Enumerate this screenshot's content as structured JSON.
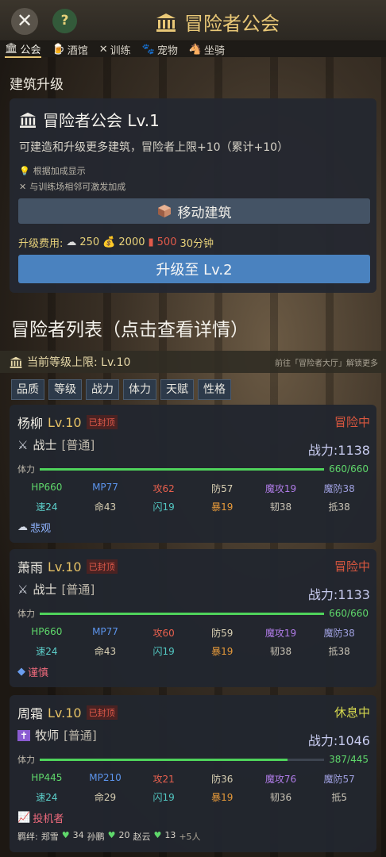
{
  "header": {
    "title": "冒险者公会",
    "close": "✕",
    "help": "?"
  },
  "tabs": [
    {
      "icon": "🏛",
      "label": "公会"
    },
    {
      "icon": "🍺",
      "label": "酒馆"
    },
    {
      "icon": "✕",
      "label": "训练"
    },
    {
      "icon": "🐾",
      "label": "宠物"
    },
    {
      "icon": "🐴",
      "label": "坐骑"
    }
  ],
  "section_title": "建筑升级",
  "building": {
    "name": "冒险者公会 Lv.1",
    "desc": "可建造和升级更多建筑，冒险者上限+10（累计+10）",
    "hint1": "根据加成显示",
    "hint2": "与训练场相邻可激发加成",
    "move_label": "移动建筑",
    "cost_label": "升级费用:",
    "cost_stone": "250",
    "cost_gold": "2000",
    "cost_red": "500",
    "cost_time": "30分钟",
    "upgrade_label": "升级至 Lv.2"
  },
  "list_title": "冒险者列表（点击查看详情）",
  "level_cap": "当前等级上限: Lv.10",
  "goto": "前往「冒险者大厅」解锁更多",
  "filters": [
    "品质",
    "等级",
    "战力",
    "体力",
    "天赋",
    "性格"
  ],
  "heroes": [
    {
      "name": "杨柳",
      "lv": "Lv.10",
      "badge": "已封顶",
      "status": "冒险中",
      "cls": "战士",
      "rank": "[普通]",
      "power": "战力:1138",
      "stam_label": "体力",
      "stam_val": "660/660",
      "stam_frac": 1.0,
      "hp": "HP660",
      "mp": "MP77",
      "atk": "攻62",
      "def": "防57",
      "mat": "魔攻19",
      "mdf": "魔防38",
      "spd": "速24",
      "luck": "命43",
      "eva": "闪19",
      "crit": "暴19",
      "res": "韧38",
      "pen": "抵38",
      "trait": "悲观"
    },
    {
      "name": "萧雨",
      "lv": "Lv.10",
      "badge": "已封顶",
      "status": "冒险中",
      "cls": "战士",
      "rank": "[普通]",
      "power": "战力:1133",
      "stam_label": "体力",
      "stam_val": "660/660",
      "stam_frac": 1.0,
      "hp": "HP660",
      "mp": "MP77",
      "atk": "攻60",
      "def": "防59",
      "mat": "魔攻19",
      "mdf": "魔防38",
      "spd": "速24",
      "luck": "命43",
      "eva": "闪19",
      "crit": "暴19",
      "res": "韧38",
      "pen": "抵38",
      "trait": "谨慎"
    },
    {
      "name": "周霜",
      "lv": "Lv.10",
      "badge": "已封顶",
      "status": "休息中",
      "cls": "牧师",
      "rank": "[普通]",
      "power": "战力:1046",
      "stam_label": "体力",
      "stam_val": "387/445",
      "stam_frac": 0.87,
      "hp": "HP445",
      "mp": "MP210",
      "atk": "攻21",
      "def": "防36",
      "mat": "魔攻76",
      "mdf": "魔防57",
      "spd": "速24",
      "luck": "命29",
      "eva": "闪19",
      "crit": "暴19",
      "res": "韧36",
      "pen": "抵5",
      "trait": "投机者",
      "bond_label": "羁绊:",
      "bond1": "郑雪",
      "bond1v": "34",
      "bond2": "孙鹏",
      "bond2v": "20",
      "bond3": "赵云",
      "bond3v": "13",
      "bond_more": "+5人"
    }
  ],
  "colors": {
    "gold": "#e9c877",
    "green": "#4fd35b",
    "blue_btn": "#4a82bf"
  }
}
